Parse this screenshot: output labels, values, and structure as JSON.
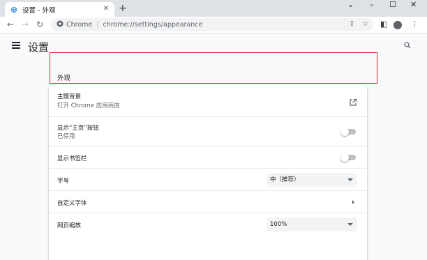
{
  "browser": {
    "tab": {
      "title": "设置 - 外观",
      "close": "✕"
    },
    "new_tab": "+",
    "window_controls": {
      "dropdown": "⌄",
      "minimize": "–",
      "maximize": "☐",
      "close": "✕"
    },
    "nav": {
      "back": "←",
      "forward": "→",
      "reload": "↻"
    },
    "omnibox": {
      "site": "Chrome",
      "separator": "|",
      "url": "chrome://settings/appearance"
    },
    "toolbar_icons": {
      "share": "⇪",
      "bookmark": "☆",
      "sidepanel": "◧",
      "menu": "⋮"
    }
  },
  "settings": {
    "title": "设置",
    "section": "外观",
    "rows": {
      "theme": {
        "label": "主题背景",
        "sublabel": "打开 Chrome 应用商店"
      },
      "home_button": {
        "label": "显示“主页”按钮",
        "sublabel": "已停用",
        "enabled": false
      },
      "bookmarks_bar": {
        "label": "显示书签栏",
        "enabled": false
      },
      "font_size": {
        "label": "字号",
        "value": "中（推荐）"
      },
      "custom_fonts": {
        "label": "自定义字体"
      },
      "page_zoom": {
        "label": "网页缩放",
        "value": "100%"
      }
    }
  },
  "colors": {
    "accent": "#1a73e8",
    "highlight": "#e02020"
  }
}
